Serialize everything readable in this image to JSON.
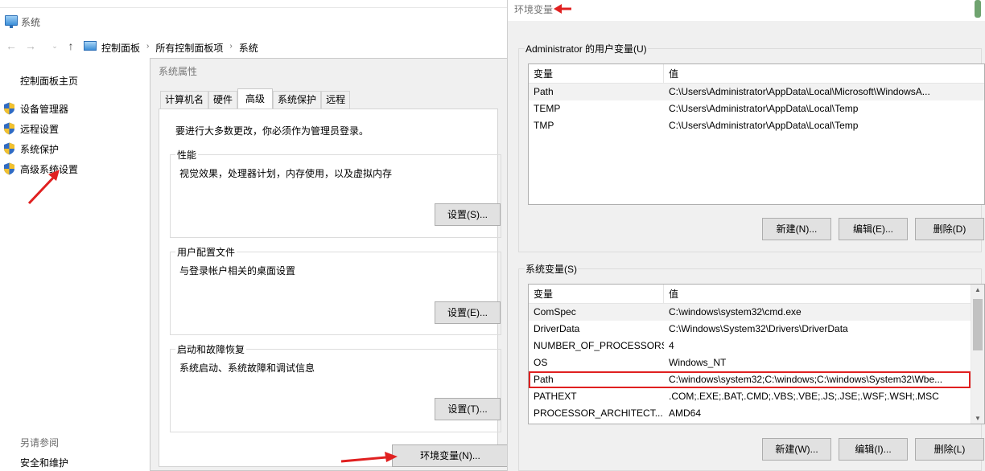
{
  "system_window": {
    "title": "系统",
    "breadcrumbs": [
      "控制面板",
      "所有控制面板项",
      "系统"
    ],
    "sidebar_home": "控制面板主页",
    "sidebar_links": [
      {
        "label": "设备管理器",
        "icon": "shield-icon"
      },
      {
        "label": "远程设置",
        "icon": "shield-icon"
      },
      {
        "label": "系统保护",
        "icon": "shield-icon"
      },
      {
        "label": "高级系统设置",
        "icon": "shield-icon"
      }
    ],
    "see_also_label": "另请参阅",
    "security_link": "安全和维护"
  },
  "system_properties": {
    "title": "系统属性",
    "tabs": [
      "计算机名",
      "硬件",
      "高级",
      "系统保护",
      "远程"
    ],
    "active_tab": "高级",
    "admin_note": "要进行大多数更改，你必须作为管理员登录。",
    "groups": [
      {
        "label": "性能",
        "desc": "视觉效果，处理器计划，内存使用，以及虚拟内存",
        "button": "设置(S)..."
      },
      {
        "label": "用户配置文件",
        "desc": "与登录帐户相关的桌面设置",
        "button": "设置(E)..."
      },
      {
        "label": "启动和故障恢复",
        "desc": "系统启动、系统故障和调试信息",
        "button": "设置(T)..."
      }
    ],
    "env_button": "环境变量(N)..."
  },
  "env_vars": {
    "title": "环境变量",
    "user_group_label": "Administrator 的用户变量(U)",
    "col_var": "变量",
    "col_val": "值",
    "user_vars": [
      {
        "name": "Path",
        "value": "C:\\Users\\Administrator\\AppData\\Local\\Microsoft\\WindowsA..."
      },
      {
        "name": "TEMP",
        "value": "C:\\Users\\Administrator\\AppData\\Local\\Temp"
      },
      {
        "name": "TMP",
        "value": "C:\\Users\\Administrator\\AppData\\Local\\Temp"
      }
    ],
    "user_buttons": {
      "new": "新建(N)...",
      "edit": "编辑(E)...",
      "delete": "删除(D)"
    },
    "system_group_label": "系统变量(S)",
    "system_vars": [
      {
        "name": "ComSpec",
        "value": "C:\\windows\\system32\\cmd.exe"
      },
      {
        "name": "DriverData",
        "value": "C:\\Windows\\System32\\Drivers\\DriverData"
      },
      {
        "name": "NUMBER_OF_PROCESSORS",
        "value": "4"
      },
      {
        "name": "OS",
        "value": "Windows_NT"
      },
      {
        "name": "Path",
        "value": "C:\\windows\\system32;C:\\windows;C:\\windows\\System32\\Wbe..."
      },
      {
        "name": "PATHEXT",
        "value": ".COM;.EXE;.BAT;.CMD;.VBS;.VBE;.JS;.JSE;.WSF;.WSH;.MSC"
      },
      {
        "name": "PROCESSOR_ARCHITECT...",
        "value": "AMD64"
      }
    ],
    "system_buttons": {
      "new": "新建(W)...",
      "edit": "编辑(I)...",
      "delete": "删除(L)"
    }
  },
  "colors": {
    "annotation_red": "#e02020",
    "dialog_bg": "#f0f0f0",
    "button_bg": "#e1e1e1"
  }
}
